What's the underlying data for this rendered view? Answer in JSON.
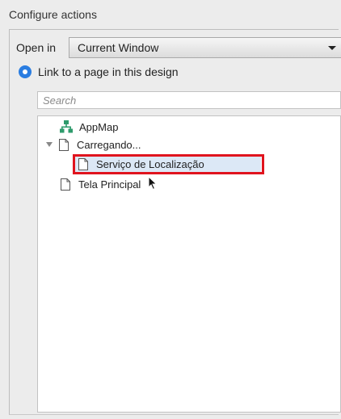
{
  "section": {
    "title": "Configure actions"
  },
  "open_in": {
    "label": "Open in",
    "selected": "Current Window"
  },
  "link_option": {
    "label": "Link to a page in this design"
  },
  "search": {
    "placeholder": "Search"
  },
  "tree": {
    "items": [
      {
        "label": "AppMap",
        "icon": "sitemap-icon"
      },
      {
        "label": "Carregando...",
        "icon": "page-icon"
      },
      {
        "label": "Serviço de Localização",
        "icon": "page-icon"
      },
      {
        "label": "Tela Principal",
        "icon": "page-icon"
      }
    ]
  },
  "colors": {
    "accent": "#2a7de1",
    "highlight": "#e0141e",
    "sitemap_icon": "#2f9b6c"
  }
}
